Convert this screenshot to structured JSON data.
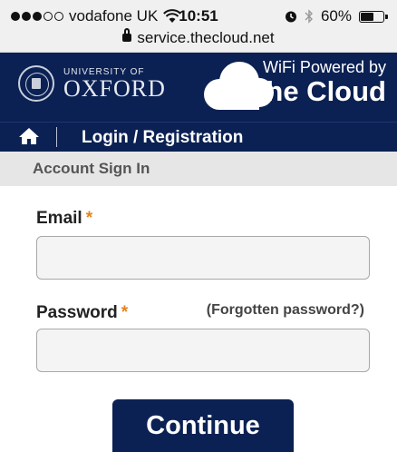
{
  "status_bar": {
    "signal_filled": 3,
    "signal_total": 5,
    "carrier": "vodafone UK",
    "wifi_icon": "wifi-icon",
    "time": "10:51",
    "alarm_icon": "alarm-icon",
    "bluetooth_icon": "bluetooth-icon",
    "battery_percent": "60%",
    "battery_level": 0.6,
    "url": "service.thecloud.net"
  },
  "header": {
    "oxford_small": "UNIVERSITY OF",
    "oxford_big": "OXFORD",
    "cloud_tagline": "WiFi Powered by",
    "cloud_brand": "The Cloud"
  },
  "nav": {
    "home_icon": "home-icon",
    "link_label": "Login / Registration"
  },
  "account": {
    "title": "Account Sign In"
  },
  "form": {
    "email_label": "Email",
    "email_value": "",
    "password_label": "Password",
    "password_value": "",
    "required_mark": "*",
    "forgot_label": "(Forgotten password?)",
    "submit_label": "Continue"
  },
  "colors": {
    "brand_navy": "#0b2153",
    "required_orange": "#e6821e",
    "field_bg": "#f4f4f4"
  }
}
